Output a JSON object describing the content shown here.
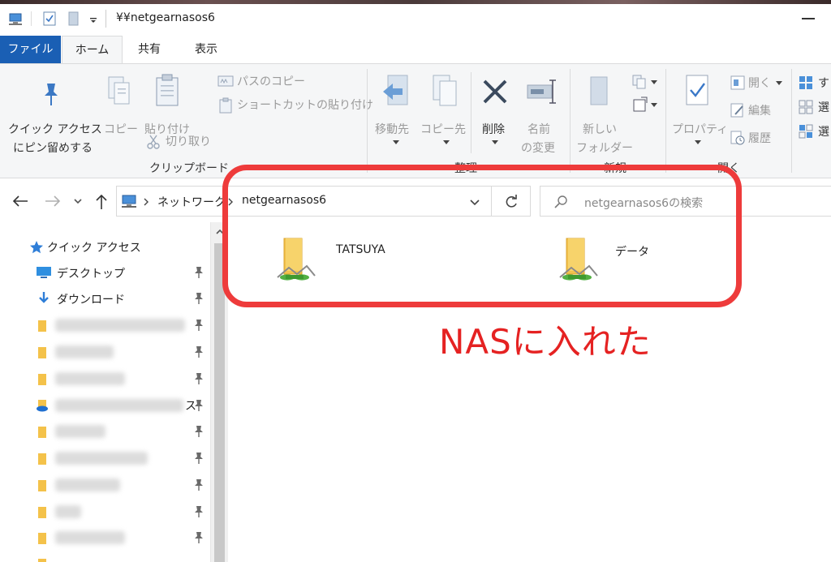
{
  "window": {
    "title": "¥¥netgearnasos6"
  },
  "tabs": [
    {
      "label": "ファイル"
    },
    {
      "label": "ホーム"
    },
    {
      "label": "共有"
    },
    {
      "label": "表示"
    }
  ],
  "ribbon": {
    "clipboard": {
      "pin_line1": "クイック アクセス",
      "pin_line2": "にピン留めする",
      "copy": "コピー",
      "paste": "貼り付け",
      "copy_path": "パスのコピー",
      "paste_shortcut": "ショートカットの貼り付け",
      "cut": "切り取り",
      "group_label": "クリップボード"
    },
    "organize": {
      "move_to": "移動先",
      "copy_to": "コピー先",
      "delete": "削除",
      "rename_line1": "名前",
      "rename_line2": "の変更",
      "group_label": "整理"
    },
    "new": {
      "new_folder_line1": "新しい",
      "new_folder_line2": "フォルダー",
      "group_label": "新規"
    },
    "open": {
      "properties": "プロパティ",
      "open": "開く",
      "edit": "編集",
      "history": "履歴",
      "group_label": "開く"
    },
    "select": {
      "select_all": "す",
      "select_none": "選",
      "invert": "選"
    }
  },
  "address": {
    "segments": [
      "ネットワーク",
      "netgearnasos6"
    ],
    "search_placeholder": "netgearnasos6の検索"
  },
  "sidebar": {
    "quick_access": "クイック アクセス",
    "items": [
      {
        "label": "デスクトップ",
        "icon": "desktop-icon",
        "pinned": true
      },
      {
        "label": "ダウンロード",
        "icon": "download-icon",
        "pinned": true
      }
    ],
    "onedrive_suffix": "ス"
  },
  "content": {
    "folders": [
      {
        "name": "TATSUYA",
        "icon": "network-folder-icon"
      },
      {
        "name": "データ",
        "icon": "network-folder-icon"
      }
    ]
  },
  "annotation": {
    "text": "NASに入れた",
    "color": "#e52222"
  },
  "colors": {
    "file_tab": "#1a5fb4",
    "ribbon_bg": "#f5f6f7",
    "annotation_border": "#ee3b3b"
  }
}
